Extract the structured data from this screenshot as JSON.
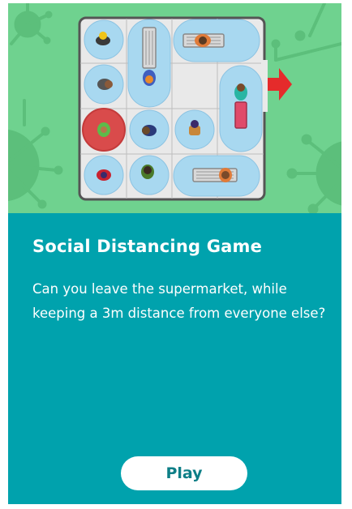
{
  "card": {
    "title": "Social Distancing Game",
    "description": "Can you leave the supermarket, while keeping a 3m distance from everyone else?",
    "play_label": "Play"
  },
  "colors": {
    "hero_background": "#6fd28f",
    "card_background": "#00a2ad",
    "exit_arrow": "#e52b2b",
    "player_zone": "#d94b4b",
    "distance_zone": "#a8d8f0"
  },
  "icons": [
    "virus-icon",
    "exit-arrow-icon",
    "shopper-icon",
    "shopping-cart-icon"
  ]
}
